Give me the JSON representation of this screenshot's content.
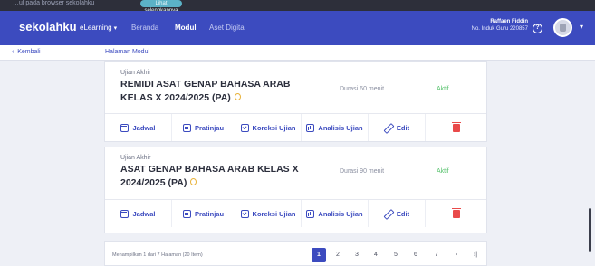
{
  "browser": {
    "strip_text": "…ul pada browser sekolahku",
    "strip_button": "Lihat selengkapnya"
  },
  "navbar": {
    "brand": "sekolahku",
    "items": [
      {
        "label": "eLearning"
      },
      {
        "label": "Beranda"
      },
      {
        "label": "Modul"
      },
      {
        "label": "Aset Digital"
      }
    ],
    "user_name": "Raffaen Fiddin",
    "user_nik": "No. Induk Guru 220857"
  },
  "subbar": {
    "back_label": "Kembali",
    "breadcrumb": "Halaman Modul"
  },
  "exams": [
    {
      "type": "Ujian Akhir",
      "title": "REMIDI ASAT GENAP BAHASA ARAB KELAS X 2024/2025 (PA)",
      "duration": "Durasi 60 menit",
      "status": "Aktif",
      "actions": [
        "Jadwal",
        "Pratinjau",
        "Koreksi Ujian",
        "Analisis Ujian",
        "Edit"
      ]
    },
    {
      "type": "Ujian Akhir",
      "title": "ASAT GENAP BAHASA ARAB KELAS X 2024/2025 (PA)",
      "duration": "Durasi 90 menit",
      "status": "Aktif",
      "actions": [
        "Jadwal",
        "Pratinjau",
        "Koreksi Ujian",
        "Analisis Ujian",
        "Edit"
      ]
    }
  ],
  "pagination": {
    "info": "Menampilkan 1 dari 7 Halaman (20 Item)",
    "pages": [
      "1",
      "2",
      "3",
      "4",
      "5",
      "6",
      "7"
    ],
    "next": "›",
    "last": "›|",
    "current": 1
  },
  "colors": {
    "primary": "#3c4bbf",
    "status_active": "#57c26d",
    "delete": "#e94a4a",
    "coin": "#e8b23a"
  },
  "icons": [
    "calendar-icon",
    "preview-icon",
    "check-icon",
    "chart-icon",
    "edit-icon",
    "trash-icon",
    "coin-icon",
    "help-icon",
    "chevron-down-icon",
    "chevron-left-icon"
  ]
}
